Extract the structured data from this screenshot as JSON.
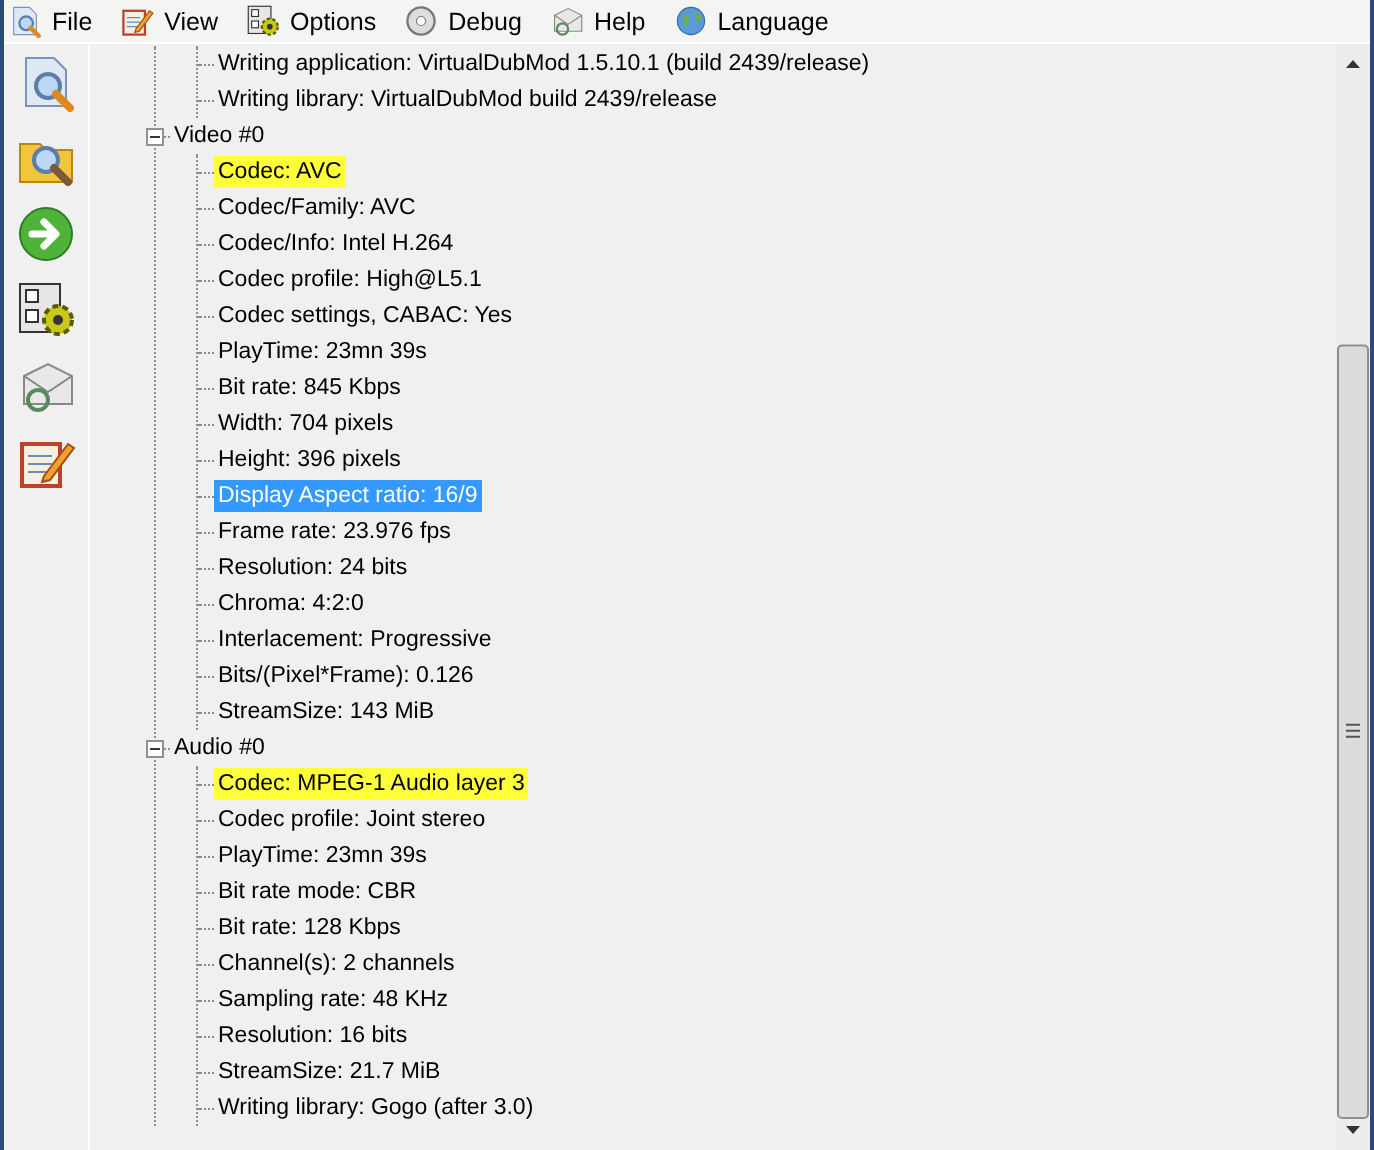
{
  "menu": [
    {
      "label": "File"
    },
    {
      "label": "View"
    },
    {
      "label": "Options"
    },
    {
      "label": "Debug"
    },
    {
      "label": "Help"
    },
    {
      "label": "Language"
    }
  ],
  "tree": [
    {
      "kind": "leaf",
      "label": "Writing application: VirtualDubMod 1.5.10.1 (build 2439/release)",
      "selected": false,
      "highlighted": false
    },
    {
      "kind": "leaf",
      "label": "Writing library: VirtualDubMod build 2439/release",
      "selected": false,
      "highlighted": false
    },
    {
      "kind": "group",
      "label": "Video #0",
      "expanded": true,
      "children": [
        {
          "label": "Codec: AVC",
          "selected": false,
          "highlighted": true
        },
        {
          "label": "Codec/Family: AVC",
          "selected": false,
          "highlighted": false
        },
        {
          "label": "Codec/Info: Intel H.264",
          "selected": false,
          "highlighted": false
        },
        {
          "label": "Codec profile: High@L5.1",
          "selected": false,
          "highlighted": false
        },
        {
          "label": "Codec settings, CABAC: Yes",
          "selected": false,
          "highlighted": false
        },
        {
          "label": "PlayTime: 23mn 39s",
          "selected": false,
          "highlighted": false
        },
        {
          "label": "Bit rate: 845 Kbps",
          "selected": false,
          "highlighted": false
        },
        {
          "label": "Width: 704 pixels",
          "selected": false,
          "highlighted": false
        },
        {
          "label": "Height: 396 pixels",
          "selected": false,
          "highlighted": false
        },
        {
          "label": "Display Aspect ratio: 16/9",
          "selected": true,
          "highlighted": false
        },
        {
          "label": "Frame rate: 23.976 fps",
          "selected": false,
          "highlighted": false
        },
        {
          "label": "Resolution: 24 bits",
          "selected": false,
          "highlighted": false
        },
        {
          "label": "Chroma: 4:2:0",
          "selected": false,
          "highlighted": false
        },
        {
          "label": "Interlacement: Progressive",
          "selected": false,
          "highlighted": false
        },
        {
          "label": "Bits/(Pixel*Frame): 0.126",
          "selected": false,
          "highlighted": false
        },
        {
          "label": "StreamSize: 143 MiB",
          "selected": false,
          "highlighted": false
        }
      ]
    },
    {
      "kind": "group",
      "label": "Audio #0",
      "expanded": true,
      "children": [
        {
          "label": "Codec: MPEG-1 Audio layer 3",
          "selected": false,
          "highlighted": true
        },
        {
          "label": "Codec profile: Joint stereo",
          "selected": false,
          "highlighted": false
        },
        {
          "label": "PlayTime: 23mn 39s",
          "selected": false,
          "highlighted": false
        },
        {
          "label": "Bit rate mode: CBR",
          "selected": false,
          "highlighted": false
        },
        {
          "label": "Bit rate: 128 Kbps",
          "selected": false,
          "highlighted": false
        },
        {
          "label": "Channel(s): 2 channels",
          "selected": false,
          "highlighted": false
        },
        {
          "label": "Sampling rate: 48 KHz",
          "selected": false,
          "highlighted": false
        },
        {
          "label": "Resolution: 16 bits",
          "selected": false,
          "highlighted": false
        },
        {
          "label": "StreamSize: 21.7 MiB",
          "selected": false,
          "highlighted": false
        },
        {
          "label": "Writing library: Gogo (after 3.0)",
          "selected": false,
          "highlighted": false
        }
      ]
    }
  ]
}
